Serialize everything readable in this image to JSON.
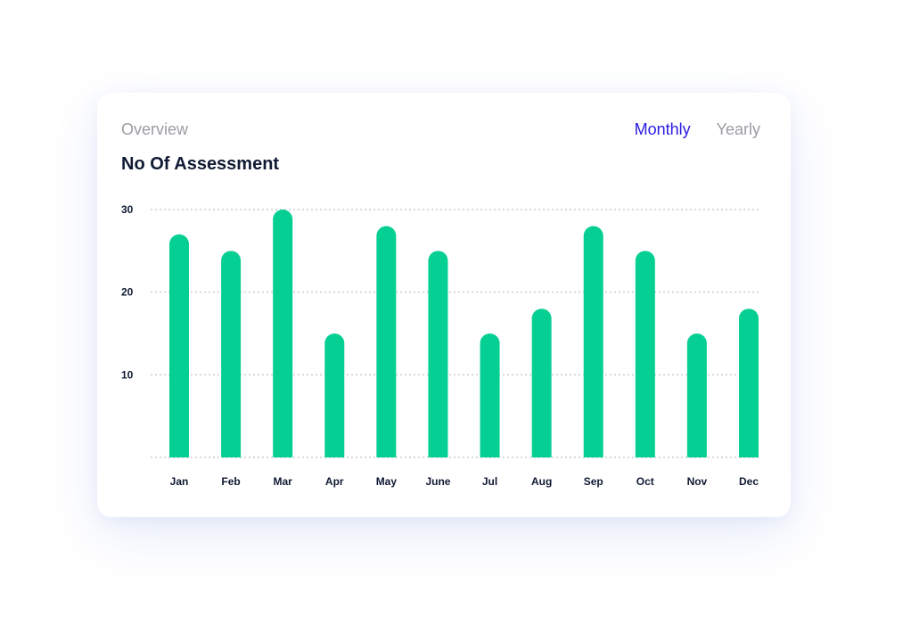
{
  "header": {
    "overview_label": "Overview",
    "tabs": [
      {
        "label": "Monthly",
        "active": true
      },
      {
        "label": "Yearly",
        "active": false
      }
    ]
  },
  "colors": {
    "bar": "#06cf93",
    "active_tab": "#2a1be0",
    "muted_text": "#9a9ca3",
    "title_text": "#101a33",
    "grid": "#c9ccd3"
  },
  "chart_data": {
    "type": "bar",
    "title": "No Of Assessment",
    "categories": [
      "Jan",
      "Feb",
      "Mar",
      "Apr",
      "May",
      "June",
      "Jul",
      "Aug",
      "Sep",
      "Oct",
      "Nov",
      "Dec"
    ],
    "values": [
      27,
      25,
      30,
      15,
      28,
      25,
      15,
      18,
      28,
      25,
      15,
      18
    ],
    "yticks": [
      10,
      20,
      30
    ],
    "ylim": [
      0,
      30
    ],
    "grid": true,
    "bar_shape": "rounded-top"
  }
}
